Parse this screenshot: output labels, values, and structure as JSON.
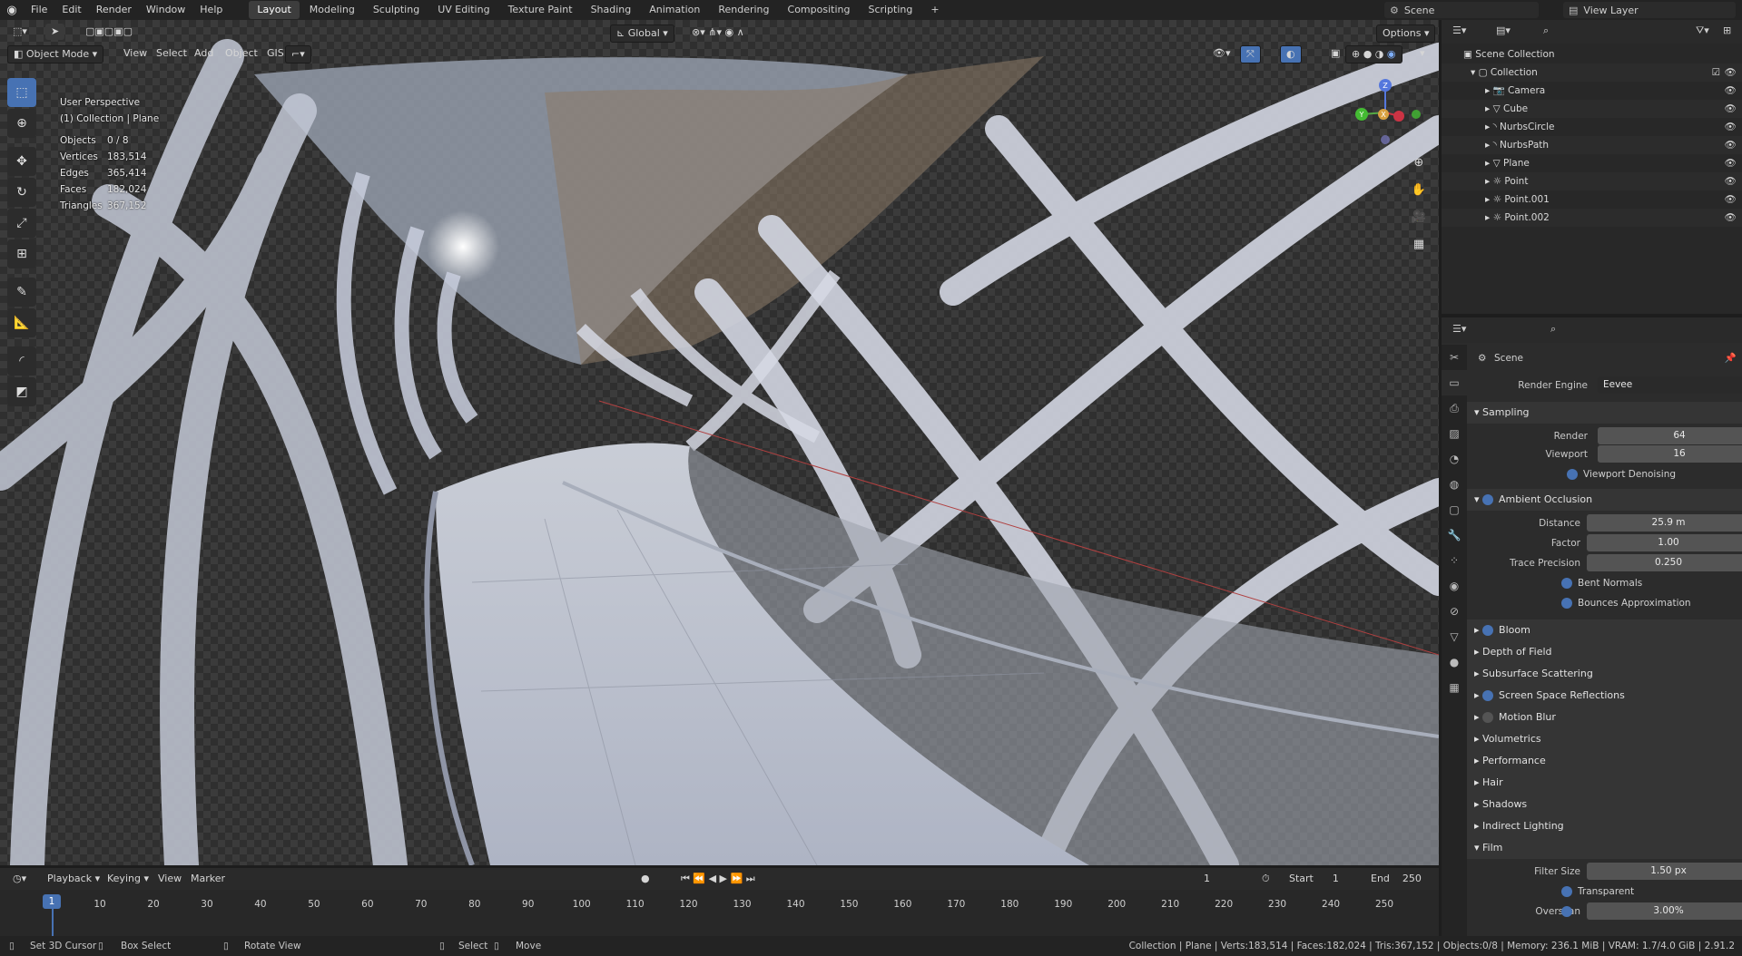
{
  "topbar": {
    "menus": [
      "File",
      "Edit",
      "Render",
      "Window",
      "Help"
    ],
    "workspaces": [
      "Layout",
      "Modeling",
      "Sculpting",
      "UV Editing",
      "Texture Paint",
      "Shading",
      "Animation",
      "Rendering",
      "Compositing",
      "Scripting"
    ],
    "active_workspace": "Layout",
    "add_tab": "+",
    "scene": "Scene",
    "view_layer": "View Layer"
  },
  "viewport": {
    "mode": "Object Mode",
    "menus": [
      "View",
      "Select",
      "Add",
      "Object",
      "GIS"
    ],
    "orientation": "Global",
    "options": "Options",
    "perspective": "User Perspective",
    "collection_info": "(1) Collection | Plane",
    "stats": [
      {
        "label": "Objects",
        "value": "0 / 8"
      },
      {
        "label": "Vertices",
        "value": "183,514"
      },
      {
        "label": "Edges",
        "value": "365,414"
      },
      {
        "label": "Faces",
        "value": "182,024"
      },
      {
        "label": "Triangles",
        "value": "367,152"
      }
    ],
    "gizmo": {
      "z": "Z",
      "y": "Y",
      "x": "X"
    }
  },
  "outliner": {
    "root": "Scene Collection",
    "collection": "Collection",
    "items": [
      "Camera",
      "Cube",
      "NurbsCircle",
      "NurbsPath",
      "Plane",
      "Point",
      "Point.001",
      "Point.002"
    ]
  },
  "properties": {
    "context": "Scene",
    "render_engine_label": "Render Engine",
    "render_engine": "Eevee",
    "sampling": {
      "title": "Sampling",
      "render_label": "Render",
      "render": "64",
      "viewport_label": "Viewport",
      "viewport": "16",
      "denoise": "Viewport Denoising"
    },
    "ao": {
      "title": "Ambient Occlusion",
      "distance_label": "Distance",
      "distance": "25.9 m",
      "factor_label": "Factor",
      "factor": "1.00",
      "trace_label": "Trace Precision",
      "trace": "0.250",
      "bent": "Bent Normals",
      "bounces": "Bounces Approximation"
    },
    "panels": [
      "Bloom",
      "Depth of Field",
      "Subsurface Scattering",
      "Screen Space Reflections",
      "Motion Blur",
      "Volumetrics",
      "Performance",
      "Hair",
      "Shadows",
      "Indirect Lighting",
      "Film"
    ],
    "film": {
      "filter_label": "Filter Size",
      "filter": "1.50 px",
      "transparent": "Transparent",
      "overscan_label": "Overscan",
      "overscan": "3.00%"
    }
  },
  "timeline": {
    "menus": [
      "Playback",
      "Keying",
      "View",
      "Marker"
    ],
    "current_frame": "1",
    "start_label": "Start",
    "start": "1",
    "end_label": "End",
    "end": "250",
    "ticks": [
      "1",
      "10",
      "20",
      "30",
      "40",
      "50",
      "60",
      "70",
      "80",
      "90",
      "100",
      "110",
      "120",
      "130",
      "140",
      "150",
      "160",
      "170",
      "180",
      "190",
      "200",
      "210",
      "220",
      "230",
      "240",
      "250"
    ],
    "frame_indicator": "1"
  },
  "statusbar": {
    "hints": [
      "Set 3D Cursor",
      "Box Select",
      "Rotate View",
      "Select",
      "Move"
    ],
    "info": "Collection | Plane | Verts:183,514 | Faces:182,024 | Tris:367,152 | Objects:0/8 | Memory: 236.1 MiB | VRAM: 1.7/4.0 GiB | 2.91.2"
  }
}
